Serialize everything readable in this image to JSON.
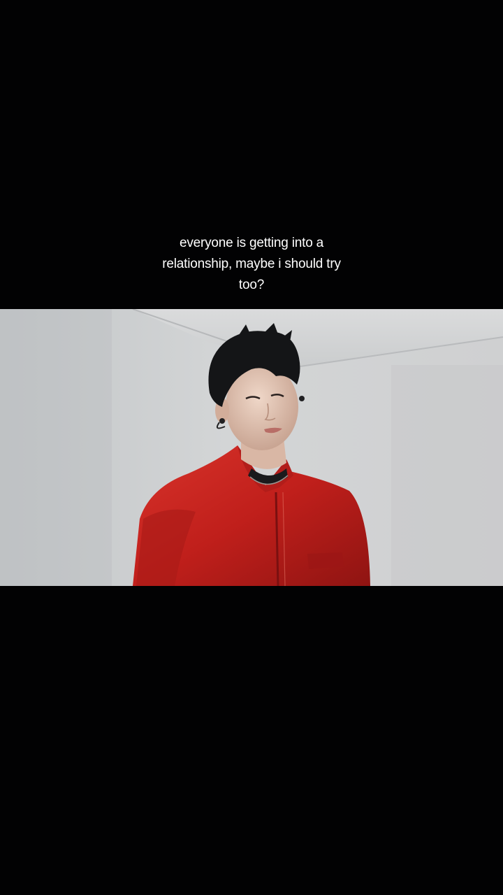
{
  "caption": {
    "lines": [
      "everyone is getting into a",
      "relationship, maybe i should try",
      "too?"
    ]
  },
  "colors": {
    "background": "#020203",
    "caption_text": "#ffffff",
    "wall": "#c9cbcd",
    "jacket": "#c8231f",
    "hair": "#141517"
  },
  "icons": {
    "video_frame": "video-still-image"
  }
}
